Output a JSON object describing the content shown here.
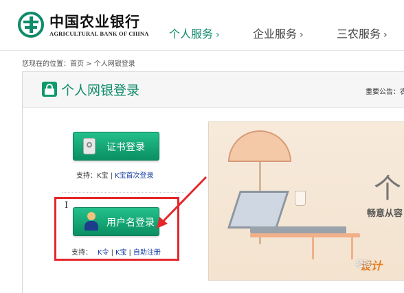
{
  "header": {
    "logo_cn": "中国农业银行",
    "logo_en": "AGRICULTURAL BANK OF CHINA",
    "nav": [
      {
        "label": "个人服务",
        "chevron": "›",
        "active": true
      },
      {
        "label": "企业服务",
        "chevron": "›",
        "active": false
      },
      {
        "label": "三农服务",
        "chevron": "›",
        "active": false
      }
    ]
  },
  "breadcrumb": {
    "prefix": "您现在的位置：",
    "home": "首页",
    "separator": " > ",
    "current": "个人网银登录"
  },
  "panel": {
    "title": "个人网银登录",
    "notice_label": "重要公告：农",
    "cert_login": {
      "label": "证书登录",
      "support_prefix": "支持：K宝",
      "support_sep": "|",
      "support_link": "K宝首次登录"
    },
    "user_login": {
      "label": "用户名登录",
      "support_prefix": "支持：",
      "links": [
        "K令",
        "K宝",
        "自助注册"
      ],
      "sep": "|"
    },
    "text_cursor": "I"
  },
  "banner": {
    "big_char": "个",
    "tagline": "畅意从容",
    "brand": "设计",
    "watermark": "经验"
  },
  "colors": {
    "brand_green": "#0e8b6a",
    "button_green": "#0a8f62",
    "highlight_red": "#e5262b",
    "link_blue": "#1a3fa8"
  },
  "icons": [
    "abc-logo-icon",
    "lock-icon",
    "cert-key-icon",
    "user-icon",
    "red-arrow-annotation"
  ]
}
